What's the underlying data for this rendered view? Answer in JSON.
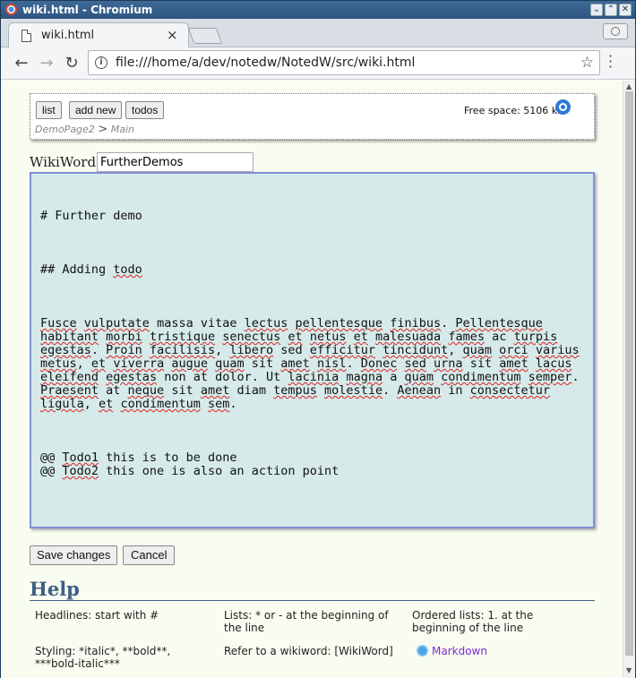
{
  "window": {
    "title": "wiki.html - Chromium"
  },
  "tab": {
    "title": "wiki.html",
    "close": "×"
  },
  "address": {
    "url": "file:///home/a/dev/notedw/NotedW/src/wiki.html"
  },
  "toolbar": {
    "list": "list",
    "add_new": "add new",
    "todos": "todos"
  },
  "status": {
    "free_space": "Free space: 5106 kB"
  },
  "breadcrumb": {
    "parent": "DemoPage2",
    "separator": ">",
    "current": "Main"
  },
  "wikiword": {
    "label": "WikiWord:",
    "value": "FurtherDemos"
  },
  "editor": {
    "h1": "# Further demo",
    "h2": [
      "## Adding ",
      "todo"
    ],
    "paragraph": [
      [
        "Fusce",
        true
      ],
      [
        " ",
        false
      ],
      [
        "vulputate",
        true
      ],
      [
        " massa vitae ",
        false
      ],
      [
        "lectus",
        true
      ],
      [
        " ",
        false
      ],
      [
        "pellentesque",
        true
      ],
      [
        " ",
        false
      ],
      [
        "finibus",
        true
      ],
      [
        ". ",
        false
      ],
      [
        "Pellentesque",
        true
      ],
      [
        " ",
        false
      ],
      [
        "habitant",
        true
      ],
      [
        " ",
        false
      ],
      [
        "morbi",
        true
      ],
      [
        " ",
        false
      ],
      [
        "tristique",
        true
      ],
      [
        " ",
        false
      ],
      [
        "senectus",
        true
      ],
      [
        " ",
        false
      ],
      [
        "et",
        true
      ],
      [
        " ",
        false
      ],
      [
        "netus",
        true
      ],
      [
        " ",
        false
      ],
      [
        "et",
        true
      ],
      [
        " ",
        false
      ],
      [
        "malesuada",
        true
      ],
      [
        " ",
        false
      ],
      [
        "fames",
        true
      ],
      [
        " ac ",
        false
      ],
      [
        "turpis",
        true
      ],
      [
        " ",
        false
      ],
      [
        "egestas",
        true
      ],
      [
        ". ",
        false
      ],
      [
        "Proin",
        true
      ],
      [
        " ",
        false
      ],
      [
        "facilisis",
        true
      ],
      [
        ", ",
        false
      ],
      [
        "libero",
        true
      ],
      [
        " sed ",
        false
      ],
      [
        "efficitur",
        true
      ],
      [
        " ",
        false
      ],
      [
        "tincidunt",
        true
      ],
      [
        ", ",
        false
      ],
      [
        "quam",
        true
      ],
      [
        " ",
        false
      ],
      [
        "orci",
        true
      ],
      [
        " ",
        false
      ],
      [
        "varius",
        true
      ],
      [
        " ",
        false
      ],
      [
        "metus",
        true
      ],
      [
        ", ",
        false
      ],
      [
        "et",
        true
      ],
      [
        " ",
        false
      ],
      [
        "viverra",
        true
      ],
      [
        " ",
        false
      ],
      [
        "augue",
        true
      ],
      [
        " ",
        false
      ],
      [
        "quam",
        true
      ],
      [
        " sit ",
        false
      ],
      [
        "amet",
        true
      ],
      [
        " ",
        false
      ],
      [
        "nisl",
        true
      ],
      [
        ". ",
        false
      ],
      [
        "Donec",
        true
      ],
      [
        " ",
        false
      ],
      [
        "sed",
        true
      ],
      [
        " ",
        false
      ],
      [
        "urna",
        true
      ],
      [
        " sit ",
        false
      ],
      [
        "amet",
        true
      ],
      [
        " ",
        false
      ],
      [
        "lacus",
        true
      ],
      [
        " ",
        false
      ],
      [
        "eleifend",
        true
      ],
      [
        " ",
        false
      ],
      [
        "egestas",
        true
      ],
      [
        " non at dolor. Ut ",
        false
      ],
      [
        "lacinia",
        true
      ],
      [
        " ",
        false
      ],
      [
        "magna",
        true
      ],
      [
        " a ",
        false
      ],
      [
        "quam",
        true
      ],
      [
        " ",
        false
      ],
      [
        "condimentum",
        true
      ],
      [
        " ",
        false
      ],
      [
        "semper",
        true
      ],
      [
        ". ",
        false
      ],
      [
        "Praesent",
        true
      ],
      [
        " at ",
        false
      ],
      [
        "neque",
        true
      ],
      [
        " sit ",
        false
      ],
      [
        "amet",
        true
      ],
      [
        " diam ",
        false
      ],
      [
        "tempus",
        true
      ],
      [
        " ",
        false
      ],
      [
        "molestie",
        true
      ],
      [
        ". ",
        false
      ],
      [
        "Aenean",
        true
      ],
      [
        " in ",
        false
      ],
      [
        "consectetur",
        true
      ],
      [
        " ",
        false
      ],
      [
        "ligula",
        true
      ],
      [
        ", ",
        false
      ],
      [
        "et",
        true
      ],
      [
        " ",
        false
      ],
      [
        "condimentum",
        true
      ],
      [
        " ",
        false
      ],
      [
        "sem",
        true
      ],
      [
        ".",
        false
      ]
    ],
    "todos": [
      [
        "@@ ",
        "Todo1",
        " this is to be done"
      ],
      [
        "@@ ",
        "Todo2",
        " this one is also an action point"
      ]
    ]
  },
  "actions": {
    "save": "Save changes",
    "cancel": "Cancel"
  },
  "help": {
    "title": "Help",
    "headlines": "Headlines: start with #",
    "lists": "Lists: * or - at the beginning of the line",
    "ordered": "Ordered lists: 1. at the beginning of the line",
    "styling": "Styling: *italic*, **bold**, ***bold-italic***",
    "refer": "Refer to a wikiword: [WikiWord]",
    "markdown": "Markdown"
  },
  "icons": {
    "app": "chromium-icon",
    "file": "file-icon",
    "info": "info-icon",
    "star": "bookmark-star-icon",
    "menu": "menu-dots-icon",
    "gear": "gear-icon",
    "markdown": "markdown-icon"
  }
}
